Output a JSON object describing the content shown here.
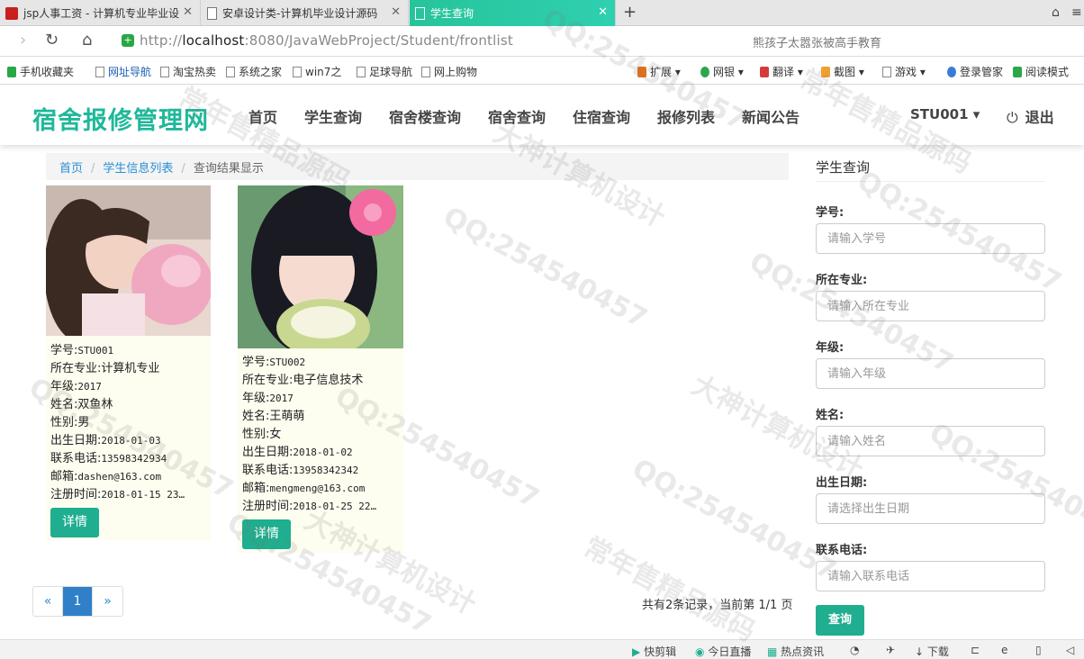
{
  "browser": {
    "tabs": [
      {
        "label": "jsp人事工资 - 计算机专业毕业设",
        "active": false
      },
      {
        "label": "安卓设计类-计算机毕业设计源码",
        "active": false
      },
      {
        "label": "学生查询",
        "active": true
      }
    ],
    "url_prefix": "http://",
    "url_host": "localhost",
    "url_rest": ":8080/JavaWebProject/Student/frontlist",
    "search_hint": "熊孩子太嚣张被高手教育",
    "bookmarks": [
      "手机收藏夹",
      "网址导航",
      "淘宝热卖",
      "系统之家",
      "win7之",
      "足球导航",
      "网上购物"
    ],
    "toolbar_items": [
      "扩展",
      "网银",
      "翻译",
      "截图",
      "游戏",
      "登录管家",
      "阅读模式"
    ]
  },
  "site": {
    "brand": "宿舍报修管理网",
    "nav": [
      "首页",
      "学生查询",
      "宿舍楼查询",
      "宿舍查询",
      "住宿查询",
      "报修列表",
      "新闻公告"
    ],
    "user": "STU001 ▾",
    "logout": "退出"
  },
  "breadcrumb": {
    "home": "首页",
    "list": "学生信息列表",
    "current": "查询结果显示"
  },
  "students": [
    {
      "id_label": "学号:",
      "id": "STU001",
      "major_label": "所在专业:",
      "major": "计算机专业",
      "grade_label": "年级:",
      "grade": "2017",
      "name_label": "姓名:",
      "name": "双鱼林",
      "sex_label": "性别:",
      "sex": "男",
      "birth_label": "出生日期:",
      "birth": "2018-01-03",
      "phone_label": "联系电话:",
      "phone": "13598342934",
      "email_label": "邮箱:",
      "email": "dashen@163.com",
      "reg_label": "注册时间:",
      "reg": "2018-01-15 23…",
      "detail": "详情"
    },
    {
      "id_label": "学号:",
      "id": "STU002",
      "major_label": "所在专业:",
      "major": "电子信息技术",
      "grade_label": "年级:",
      "grade": "2017",
      "name_label": "姓名:",
      "name": "王萌萌",
      "sex_label": "性别:",
      "sex": "女",
      "birth_label": "出生日期:",
      "birth": "2018-01-02",
      "phone_label": "联系电话:",
      "phone": "13958342342",
      "email_label": "邮箱:",
      "email": "mengmeng@163.com",
      "reg_label": "注册时间:",
      "reg": "2018-01-25 22…",
      "detail": "详情"
    }
  ],
  "pagination": {
    "prev": "«",
    "current": "1",
    "next": "»",
    "info": "共有2条记录，当前第 1/1 页"
  },
  "search": {
    "title": "学生查询",
    "fields": [
      {
        "label": "学号:",
        "placeholder": "请输入学号"
      },
      {
        "label": "所在专业:",
        "placeholder": "请输入所在专业"
      },
      {
        "label": "年级:",
        "placeholder": "请输入年级"
      },
      {
        "label": "姓名:",
        "placeholder": "请输入姓名"
      },
      {
        "label": "出生日期:",
        "placeholder": "请选择出生日期"
      },
      {
        "label": "联系电话:",
        "placeholder": "请输入联系电话"
      }
    ],
    "submit": "查询"
  },
  "statusbar": [
    "快剪辑",
    "今日直播",
    "热点资讯",
    "下载"
  ],
  "watermarks": [
    "QQ:254540457",
    "常年售精品源码",
    "大神计算机设计"
  ],
  "colors": {
    "accent": "#1fae8f",
    "brand": "#1fb89a",
    "link": "#2a8fd4",
    "tab_active": "#27c49a"
  }
}
